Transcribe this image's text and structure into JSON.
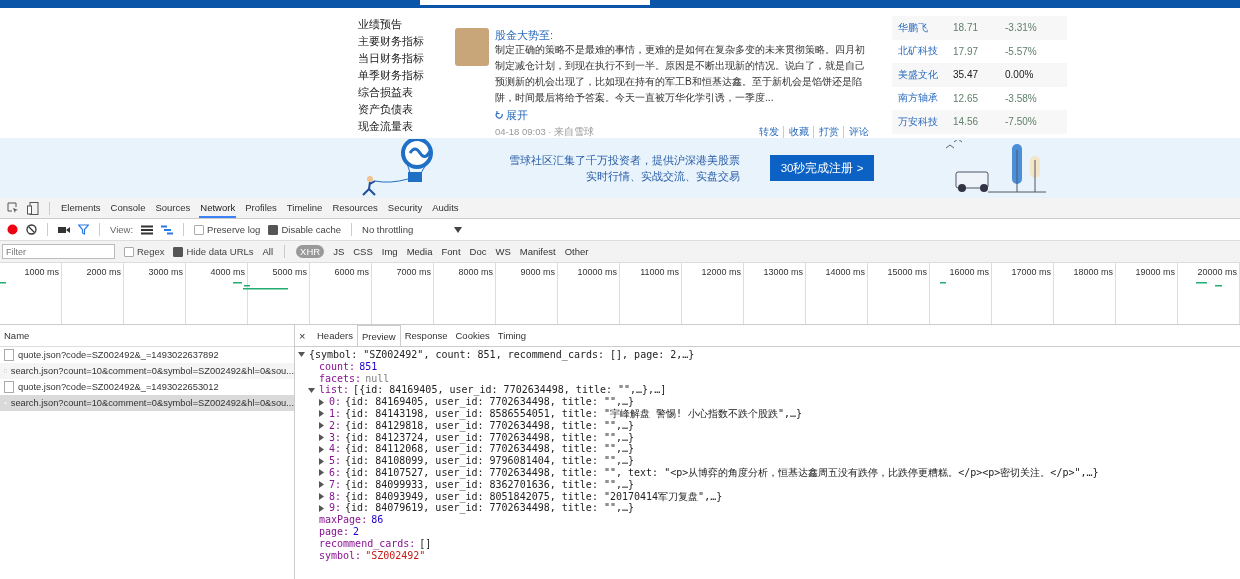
{
  "page": {
    "finance_menu": [
      "业绩预告",
      "主要财务指标",
      "当日财务指标",
      "单季财务指标",
      "综合损益表",
      "资产负债表",
      "现金流量表"
    ],
    "post": {
      "author": "股金大势至:",
      "text": "制定正确的策略不是最难的事情，更难的是如何在复杂多变的未来贯彻策略。四月初制定减仓计划，到现在执行不到一半。原因是不断出现新的情况。说白了，就是自己预测新的机会出现了，比如现在持有的军工B和恒基达鑫。至于新机会是馅饼还是陷阱，时间最后将给予答案。今天一直被万华化学引诱，一季度...",
      "expand": "展开",
      "meta": "04-18 09:03 · 来自雪球",
      "actions": [
        "转发",
        "收藏",
        "打赏",
        "评论"
      ]
    },
    "stocks": [
      {
        "name": "华鹏飞",
        "price": "18.71",
        "change": "-3.31%",
        "falling": true
      },
      {
        "name": "北矿科技",
        "price": "17.97",
        "change": "-5.57%",
        "falling": true
      },
      {
        "name": "美盛文化",
        "price": "35.47",
        "change": "0.00%",
        "falling": false
      },
      {
        "name": "南方轴承",
        "price": "12.65",
        "change": "-3.58%",
        "falling": true
      },
      {
        "name": "万安科技",
        "price": "14.56",
        "change": "-7.50%",
        "falling": true
      }
    ],
    "banner": {
      "line1": "雪球社区汇集了千万投资者，提供沪深港美股票",
      "line2": "实时行情、实战交流、实盘交易",
      "button": "30秒完成注册 >"
    }
  },
  "devtools": {
    "tabs": [
      {
        "label": "Elements",
        "selected": false
      },
      {
        "label": "Console",
        "selected": false
      },
      {
        "label": "Sources",
        "selected": false
      },
      {
        "label": "Network",
        "selected": true
      },
      {
        "label": "Profiles",
        "selected": false
      },
      {
        "label": "Timeline",
        "selected": false
      },
      {
        "label": "Resources",
        "selected": false
      },
      {
        "label": "Security",
        "selected": false
      },
      {
        "label": "Audits",
        "selected": false
      }
    ],
    "toolbar": {
      "recording": true,
      "view_label": "View:",
      "preserve_log": {
        "label": "Preserve log",
        "checked": false
      },
      "disable_cache": {
        "label": "Disable cache",
        "checked": true
      },
      "throttling": "No throttling"
    },
    "filter": {
      "placeholder": "Filter",
      "regex": {
        "label": "Regex",
        "checked": false
      },
      "hide_data_urls": {
        "label": "Hide data URLs",
        "checked": true
      },
      "types": [
        {
          "label": "All",
          "selected": false
        },
        {
          "label": "XHR",
          "selected": true
        },
        {
          "label": "JS",
          "selected": false
        },
        {
          "label": "CSS",
          "selected": false
        },
        {
          "label": "Img",
          "selected": false
        },
        {
          "label": "Media",
          "selected": false
        },
        {
          "label": "Font",
          "selected": false
        },
        {
          "label": "Doc",
          "selected": false
        },
        {
          "label": "WS",
          "selected": false
        },
        {
          "label": "Manifest",
          "selected": false
        },
        {
          "label": "Other",
          "selected": false
        }
      ]
    },
    "timeline_ticks": [
      "1000 ms",
      "2000 ms",
      "3000 ms",
      "4000 ms",
      "5000 ms",
      "6000 ms",
      "7000 ms",
      "8000 ms",
      "9000 ms",
      "10000 ms",
      "11000 ms",
      "12000 ms",
      "13000 ms",
      "14000 ms",
      "15000 ms",
      "16000 ms",
      "17000 ms",
      "18000 ms",
      "19000 ms",
      "20000 ms"
    ],
    "requests": {
      "column": "Name",
      "rows": [
        {
          "name": "quote.json?code=SZ002492&_=1493022637892",
          "selected": false
        },
        {
          "name": "search.json?count=10&comment=0&symbol=SZ002492&hl=0&sou...",
          "selected": false
        },
        {
          "name": "quote.json?code=SZ002492&_=1493022653012",
          "selected": false
        },
        {
          "name": "search.json?count=10&comment=0&symbol=SZ002492&hl=0&sou...",
          "selected": true
        }
      ]
    },
    "detail_close": "×",
    "detail_tabs": [
      {
        "label": "Headers",
        "selected": false
      },
      {
        "label": "Preview",
        "selected": true
      },
      {
        "label": "Response",
        "selected": false
      },
      {
        "label": "Cookies",
        "selected": false
      },
      {
        "label": "Timing",
        "selected": false
      }
    ],
    "preview": {
      "summary": "{symbol: \"SZ002492\", count: 851, recommend_cards: [], page: 2,…}",
      "expanded": true,
      "children": [
        {
          "key": "count:",
          "value": "851",
          "kind": "number"
        },
        {
          "key": "facets:",
          "value": "null",
          "kind": "null"
        },
        {
          "key": "list:",
          "summary": "[{id: 84169405, user_id: 7702634498, title: \"\",…},…]",
          "expanded": true,
          "children": [
            {
              "key": "0:",
              "summary": "{id: 84169405, user_id: 7702634498, title: \"\",…}",
              "expanded": false
            },
            {
              "key": "1:",
              "summary": "{id: 84143198, user_id: 8586554051, title: \"宇峰解盘 警惕! 小心指数不跌个股跌\",…}",
              "expanded": false
            },
            {
              "key": "2:",
              "summary": "{id: 84129818, user_id: 7702634498, title: \"\",…}",
              "expanded": false
            },
            {
              "key": "3:",
              "summary": "{id: 84123724, user_id: 7702634498, title: \"\",…}",
              "expanded": false
            },
            {
              "key": "4:",
              "summary": "{id: 84112068, user_id: 7702634498, title: \"\",…}",
              "expanded": false
            },
            {
              "key": "5:",
              "summary": "{id: 84108099, user_id: 9796081404, title: \"\",…}",
              "expanded": false
            },
            {
              "key": "6:",
              "summary": "{id: 84107527, user_id: 7702634498, title: \"\", text: \"<p>从博弈的角度分析，恒基达鑫周五没有跌停，比跌停更糟糕。</p><p>密切关注。</p>\",…}",
              "expanded": false
            },
            {
              "key": "7:",
              "summary": "{id: 84099933, user_id: 8362701636, title: \"\",…}",
              "expanded": false
            },
            {
              "key": "8:",
              "summary": "{id: 84093949, user_id: 8051842075, title: \"20170414军刀复盘\",…}",
              "expanded": false
            },
            {
              "key": "9:",
              "summary": "{id: 84079619, user_id: 7702634498, title: \"\",…}",
              "expanded": false
            }
          ]
        },
        {
          "key": "maxPage:",
          "value": "86",
          "kind": "number"
        },
        {
          "key": "page:",
          "value": "2",
          "kind": "number"
        },
        {
          "key": "recommend_cards:",
          "value": "[]",
          "kind": "plain"
        },
        {
          "key": "symbol:",
          "value": "\"SZ002492\"",
          "kind": "string"
        }
      ]
    }
  }
}
